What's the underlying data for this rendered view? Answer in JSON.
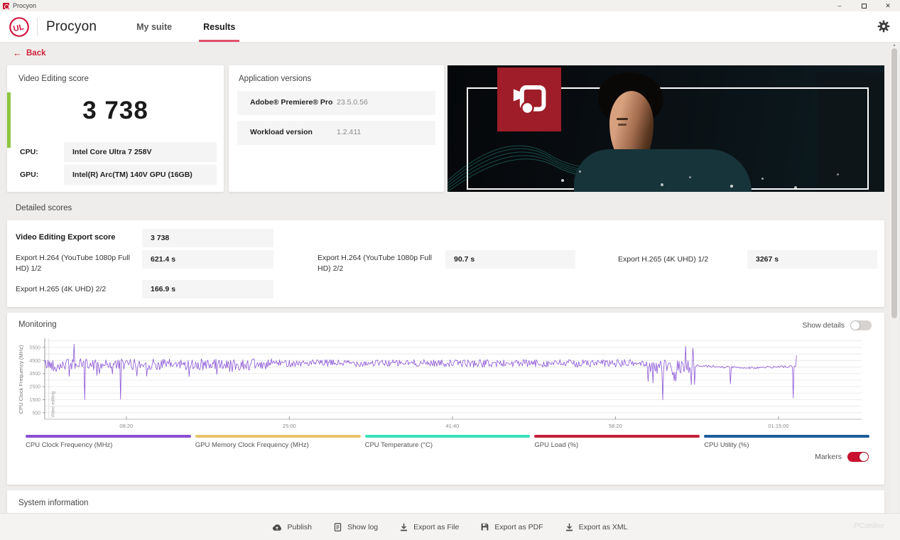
{
  "window": {
    "title": "Procyon"
  },
  "header": {
    "brand": "Procyon",
    "nav": [
      {
        "label": "My suite"
      },
      {
        "label": "Results"
      }
    ]
  },
  "back": {
    "label": "Back"
  },
  "score_card": {
    "title": "Video Editing score",
    "score": "3 738",
    "rows": [
      {
        "label": "CPU:",
        "value": "Intel Core Ultra 7 258V"
      },
      {
        "label": "GPU:",
        "value": "Intel(R) Arc(TM) 140V GPU (16GB)"
      }
    ]
  },
  "versions_card": {
    "title": "Application versions",
    "rows": [
      {
        "label": "Adobe® Premiere® Pro",
        "value": "23.5.0.56"
      },
      {
        "label": "Workload version",
        "value": "1.2.411"
      }
    ]
  },
  "detailed_scores": {
    "title": "Detailed scores",
    "main": {
      "label": "Video Editing Export score",
      "value": "3 738"
    },
    "rows": [
      {
        "label": "Export H.264 (YouTube 1080p Full HD) 1/2",
        "value": "621.4 s"
      },
      {
        "label": "Export H.264 (YouTube 1080p Full HD) 2/2",
        "value": "90.7 s"
      },
      {
        "label": "Export H.265 (4K UHD) 1/2",
        "value": "3267 s"
      },
      {
        "label": "Export H.265 (4K UHD) 2/2",
        "value": "166.9 s"
      }
    ]
  },
  "monitoring": {
    "title": "Monitoring",
    "show_details": {
      "label": "Show details",
      "on": false
    },
    "markers": {
      "label": "Markers",
      "on": true
    }
  },
  "chart_data": {
    "type": "line",
    "ylabel": "CPU Clock Frequency (MHz)",
    "ylim": [
      0,
      6100
    ],
    "y_ticks": [
      500,
      1500,
      2500,
      3500,
      4500,
      5500
    ],
    "x_ticks": [
      {
        "t": 500,
        "label": "08:20"
      },
      {
        "t": 1500,
        "label": "25:00"
      },
      {
        "t": 2500,
        "label": "41:40"
      },
      {
        "t": 3500,
        "label": "58:20"
      },
      {
        "t": 4500,
        "label": "01:15:00"
      }
    ],
    "xlim": [
      0,
      5010
    ],
    "grid": true,
    "legend_position": "bottom",
    "marker": {
      "t": 25,
      "label": "Video editing"
    },
    "series": [
      {
        "name": "CPU Clock Frequency (MHz)",
        "color": "#8a55d6",
        "unit": "MHz",
        "baseline_segments": [
          {
            "t0": 0,
            "t1": 1400,
            "mean": 4200,
            "noise": 440
          },
          {
            "t0": 1400,
            "t1": 2600,
            "mean": 4300,
            "noise": 270
          },
          {
            "t0": 2600,
            "t1": 3690,
            "mean": 4280,
            "noise": 300
          },
          {
            "t0": 3690,
            "t1": 3990,
            "mean": 3950,
            "noise": 600
          },
          {
            "t0": 3990,
            "t1": 4610,
            "mean": 4020,
            "noise": 90
          }
        ],
        "events": [
          {
            "t": 178,
            "v": 5750
          },
          {
            "t": 243,
            "v": 1500
          },
          {
            "t": 465,
            "v": 1520
          },
          {
            "t": 3789,
            "v": 1480
          },
          {
            "t": 3860,
            "v": 2950
          },
          {
            "t": 3930,
            "v": 5600
          },
          {
            "t": 3975,
            "v": 5450
          },
          {
            "t": 4205,
            "v": 2700
          },
          {
            "t": 4590,
            "v": 1620
          },
          {
            "t": 4608,
            "v": 4900
          }
        ]
      }
    ],
    "legend": [
      {
        "label": "CPU Clock Frequency (MHz)",
        "color": "#8a4fd3"
      },
      {
        "label": "GPU Memory Clock Frequency (MHz)",
        "color": "#e8c46a"
      },
      {
        "label": "CPU Temperature (°C)",
        "color": "#39e0bc"
      },
      {
        "label": "GPU Load (%)",
        "color": "#c41f3a"
      },
      {
        "label": "CPU Utility (%)",
        "color": "#1c5d9c"
      }
    ]
  },
  "system_card": {
    "title": "System information"
  },
  "footer": {
    "buttons": [
      {
        "label": "Publish",
        "icon": "cloud-upload-icon"
      },
      {
        "label": "Show log",
        "icon": "document-icon"
      },
      {
        "label": "Export as File",
        "icon": "download-icon"
      },
      {
        "label": "Export as PDF",
        "icon": "save-icon"
      },
      {
        "label": "Export as XML",
        "icon": "download-icon"
      }
    ],
    "watermark": "PConline"
  },
  "colors": {
    "accent_red": "#c8102e",
    "nav_underline": "#e2506a",
    "score_accent_green": "#8dc63f",
    "chart_line": "#8a55d6"
  }
}
